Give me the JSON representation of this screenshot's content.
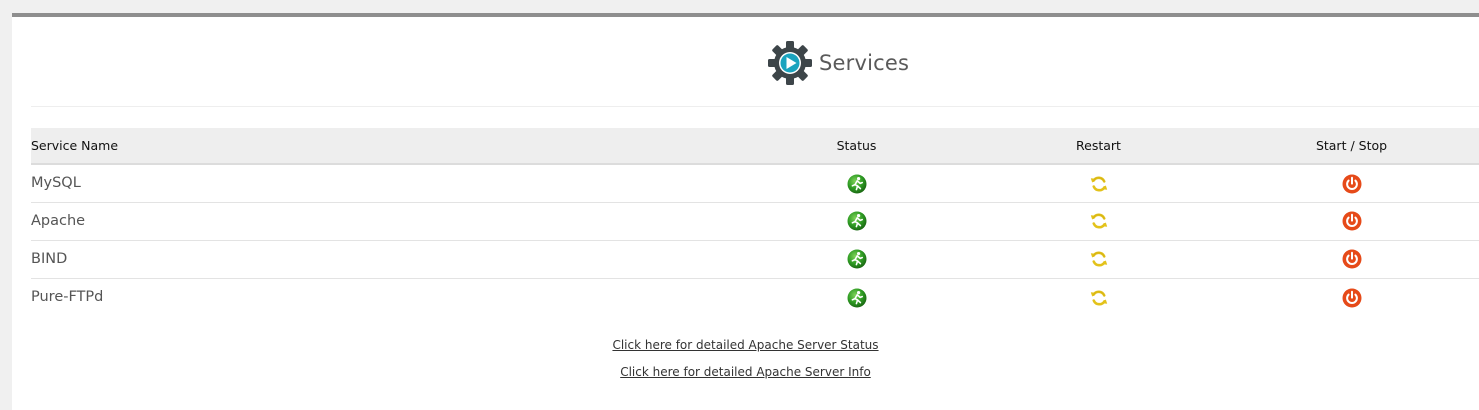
{
  "header": {
    "title": "Services",
    "icon": "gear-play-icon"
  },
  "table": {
    "columns": [
      "Service Name",
      "Status",
      "Restart",
      "Start / Stop"
    ],
    "rows": [
      {
        "name": "MySQL"
      },
      {
        "name": "Apache"
      },
      {
        "name": "BIND"
      },
      {
        "name": "Pure-FTPd"
      }
    ],
    "icons": {
      "status": "running-status-icon",
      "restart": "restart-icon",
      "start_stop": "power-icon"
    }
  },
  "links": {
    "apache_status": "Click here for detailed Apache Server Status",
    "apache_info": "Click here for detailed Apache Server Info"
  },
  "colors": {
    "gear": "#3d4549",
    "play": "#1ba3be",
    "status_green": "#2e9b23",
    "restart_yellow": "#e3c21a",
    "power_red": "#e64a19",
    "header_bg": "#eeeeee"
  }
}
